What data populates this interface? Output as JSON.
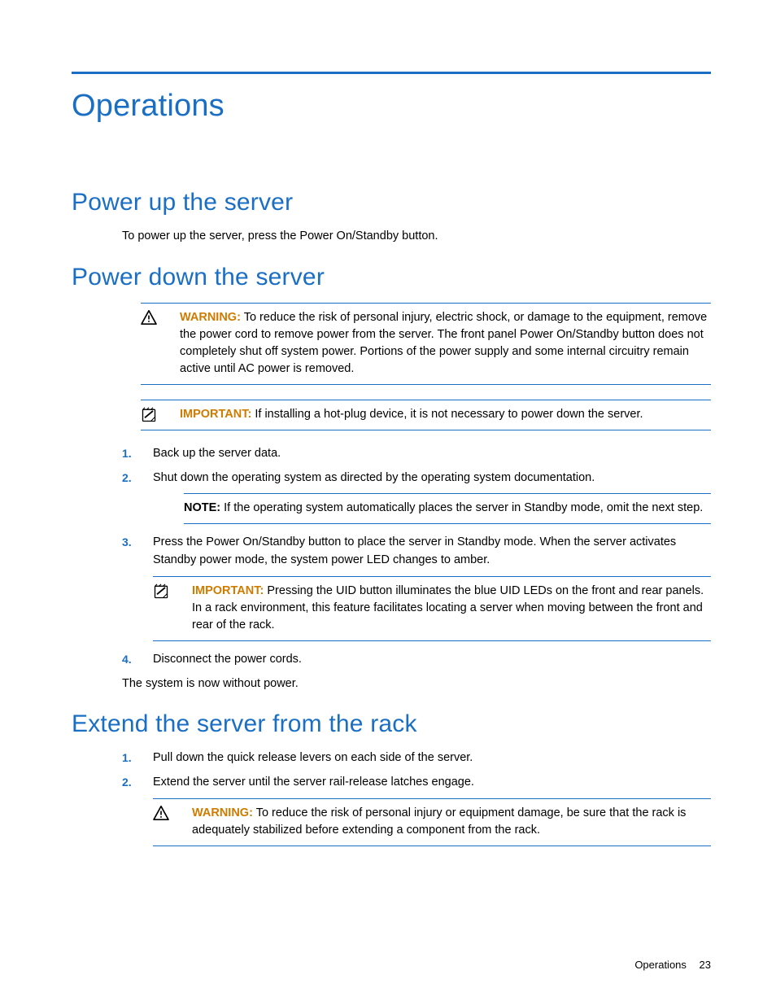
{
  "chapter_title": "Operations",
  "sections": {
    "power_up": {
      "heading": "Power up the server",
      "body": "To power up the server, press the Power On/Standby button."
    },
    "power_down": {
      "heading": "Power down the server",
      "warning_label": "WARNING:",
      "warning_text": "To reduce the risk of personal injury, electric shock, or damage to the equipment, remove the power cord to remove power from the server. The front panel Power On/Standby button does not completely shut off system power. Portions of the power supply and some internal circuitry remain active until AC power is removed.",
      "important_label": "IMPORTANT:",
      "important_text": "If installing a hot-plug device, it is not necessary to power down the server.",
      "steps": [
        {
          "num": "1.",
          "text": "Back up the server data."
        },
        {
          "num": "2.",
          "text": "Shut down the operating system as directed by the operating system documentation."
        },
        {
          "num": "3.",
          "text": "Press the Power On/Standby button to place the server in Standby mode. When the server activates Standby power mode, the system power LED changes to amber."
        },
        {
          "num": "4.",
          "text": "Disconnect the power cords."
        }
      ],
      "note_label": "NOTE:",
      "note_text": "If the operating system automatically places the server in Standby mode, omit the next step.",
      "inner_important_label": "IMPORTANT:",
      "inner_important_text": "Pressing the UID button illuminates the blue UID LEDs on the front and rear panels. In a rack environment, this feature facilitates locating a server when moving between the front and rear of the rack.",
      "conclusion": "The system is now without power."
    },
    "extend": {
      "heading": "Extend the server from the rack",
      "steps": [
        {
          "num": "1.",
          "text": "Pull down the quick release levers on each side of the server."
        },
        {
          "num": "2.",
          "text": "Extend the server until the server rail-release latches engage."
        }
      ],
      "warning_label": "WARNING:",
      "warning_text": "To reduce the risk of personal injury or equipment damage, be sure that the rack is adequately stabilized before extending a component from the rack."
    }
  },
  "footer": {
    "section": "Operations",
    "page": "23"
  }
}
